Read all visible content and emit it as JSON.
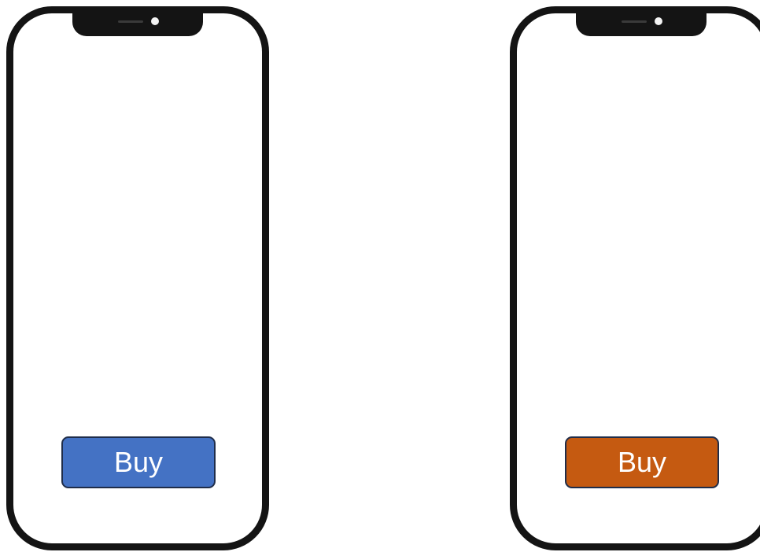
{
  "phones": [
    {
      "button": {
        "label": "Buy",
        "color": "#4472C4"
      }
    },
    {
      "button": {
        "label": "Buy",
        "color": "#C55A11"
      }
    }
  ],
  "icons": {
    "speaker": "speaker-icon",
    "camera": "camera-icon"
  }
}
